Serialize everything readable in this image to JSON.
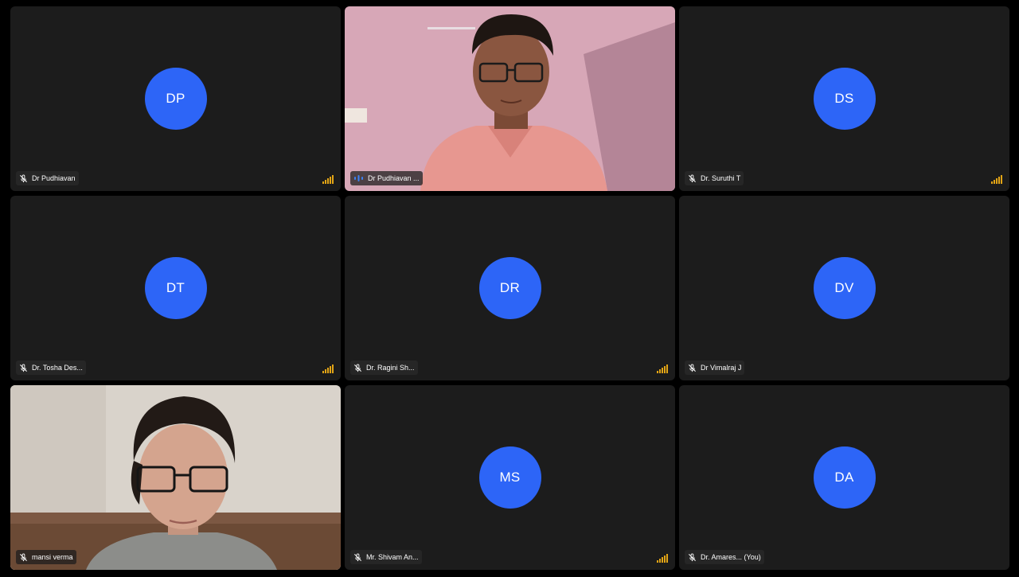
{
  "tiles": [
    {
      "initials": "DP",
      "name": "Dr Pudhiavan",
      "muted": true,
      "signal": true
    },
    {
      "initials": "",
      "name": "Dr Pudhiavan ...",
      "muted": false,
      "speaking": true,
      "video": true
    },
    {
      "initials": "DS",
      "name": "Dr. Suruthi T",
      "muted": true,
      "signal": true
    },
    {
      "initials": "DT",
      "name": "Dr. Tosha Des...",
      "muted": true,
      "signal": true
    },
    {
      "initials": "DR",
      "name": "Dr. Ragini Sh...",
      "muted": true,
      "signal": true
    },
    {
      "initials": "DV",
      "name": "Dr Vimalraj J",
      "muted": true,
      "signal": false
    },
    {
      "initials": "",
      "name": "mansi verma",
      "muted": true,
      "video": true
    },
    {
      "initials": "MS",
      "name": "Mr. Shivam An...",
      "muted": true,
      "signal": true
    },
    {
      "initials": "DA",
      "name": "Dr. Amares... (You)",
      "muted": true,
      "signal": false
    }
  ],
  "colors": {
    "avatar_bg": "#2d65f7",
    "tile_bg": "#1c1c1c",
    "signal": "#e2a415",
    "speaking_indicator": "#3b82f6"
  }
}
